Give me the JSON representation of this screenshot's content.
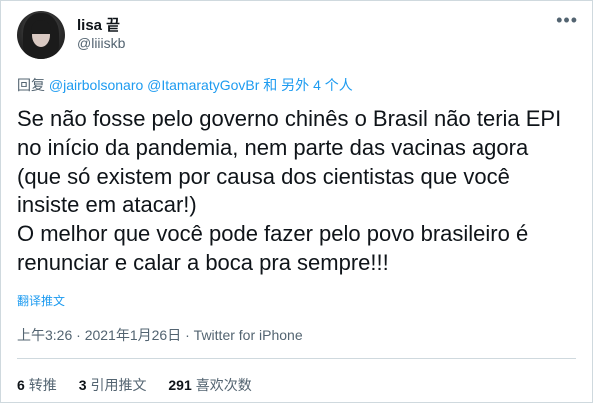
{
  "author": {
    "name": "lisa 끝",
    "handle": "@liiiskb"
  },
  "reply": {
    "prefix": "回复",
    "mention1": "@jairbolsonaro",
    "mention2": "@ItamaratyGovBr",
    "suffix": "和 另外 4 个人"
  },
  "tweet": {
    "lines": [
      "Se não fosse pelo governo chinês o Brasil não teria EPI",
      "no início da pandemia, nem parte das vacinas agora",
      "(que só existem por causa dos cientistas que você",
      "insiste em atacar!)",
      "O melhor que você pode fazer pelo povo brasileiro é",
      "renunciar e calar a boca pra sempre!!!"
    ],
    "translate_label": "翻译推文"
  },
  "meta": {
    "time": "上午3:26",
    "date": "2021年1月26日",
    "source": "Twitter for iPhone"
  },
  "stats": {
    "retweets_count": "6",
    "retweets_label": "转推",
    "quotes_count": "3",
    "quotes_label": "引用推文",
    "likes_count": "291",
    "likes_label": "喜欢次数"
  },
  "icons": {
    "more": "more-icon",
    "avatar": "avatar"
  }
}
